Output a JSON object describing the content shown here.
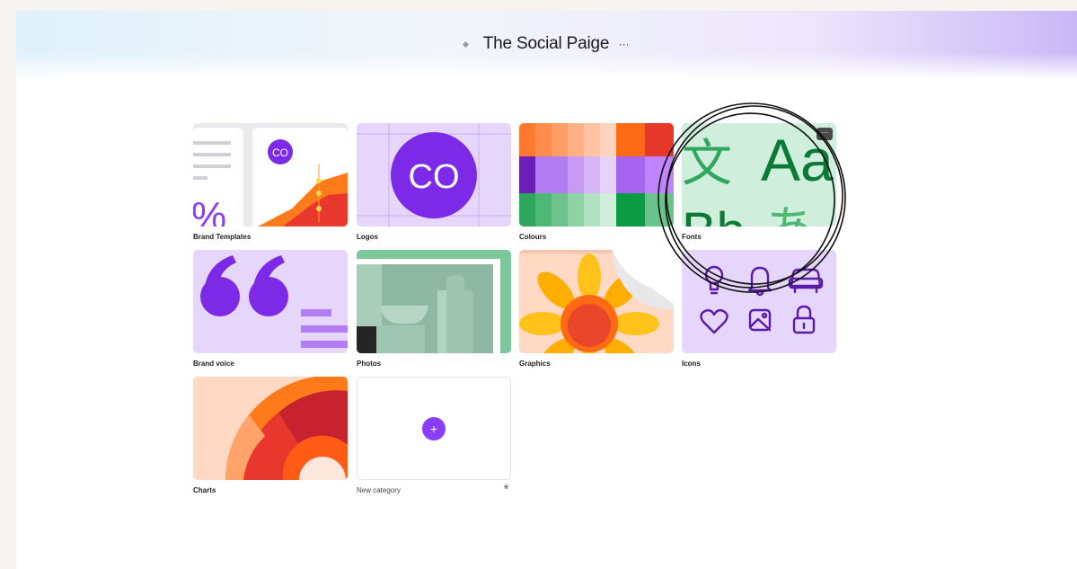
{
  "header": {
    "title": "The Social Paige",
    "more_label": "···"
  },
  "tiles": [
    {
      "label": "Brand Templates",
      "badge": "CO",
      "text": "%"
    },
    {
      "label": "Logos",
      "badge": "CO"
    },
    {
      "label": "Colours"
    },
    {
      "label": "Fonts",
      "sample_text": [
        "文",
        "Aa",
        "Bb",
        "あ"
      ],
      "more_label": "···"
    },
    {
      "label": "Brand voice"
    },
    {
      "label": "Photos"
    },
    {
      "label": "Graphics"
    },
    {
      "label": "Icons"
    },
    {
      "label": "Charts"
    },
    {
      "label": "New category",
      "add_label": "+",
      "more_label": "⋇"
    }
  ],
  "colors": {
    "accent": "#8b3dff",
    "logo_purple": "#7d2ae8",
    "tile_lilac": "#e6d6fb"
  }
}
